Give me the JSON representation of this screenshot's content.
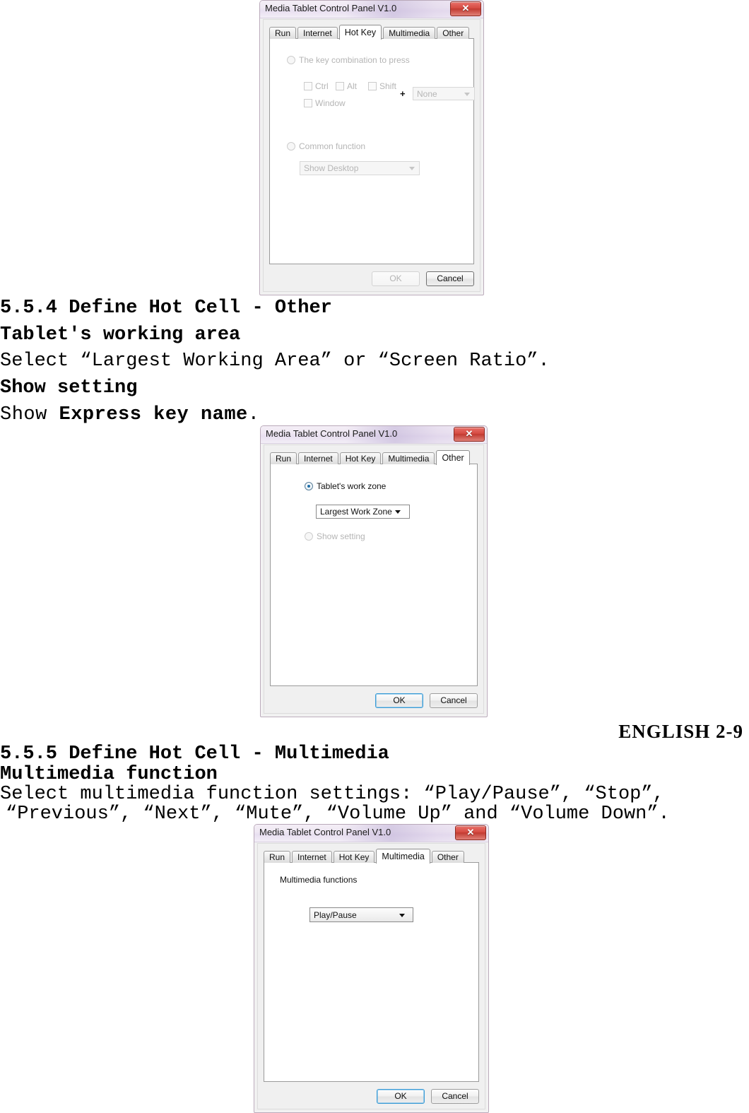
{
  "document": {
    "lines": [
      {
        "id": "s554_heading",
        "text": "5.5.4 Define Hot Cell - Other"
      },
      {
        "id": "s554_sub1",
        "text": "Tablet's working area"
      },
      {
        "id": "s554_body1",
        "text": "Select “Largest Working Area” or “Screen Ratio”."
      },
      {
        "id": "s554_sub2",
        "text": "Show setting"
      },
      {
        "id": "s554_mix_prefix",
        "text": "Show "
      },
      {
        "id": "s554_mix_bold",
        "text": "Express key name"
      },
      {
        "id": "s554_mix_suffix",
        "text": "."
      },
      {
        "id": "s555_heading",
        "text": "5.5.5 Define Hot Cell - Multimedia"
      },
      {
        "id": "s555_sub1",
        "text": "Multimedia function"
      },
      {
        "id": "s555_body1",
        "text": "Select multimedia function settings: “Play/Pause”, “Stop”,"
      },
      {
        "id": "s555_body2",
        "text": "“Previous”, “Next”, “Mute”, “Volume Up” and “Volume Down”."
      }
    ],
    "footer": "ENGLISH 2-9"
  },
  "common": {
    "window_title": "Media Tablet Control Panel V1.0",
    "close_icon": "close-icon",
    "close_glyph": "✕",
    "tabs": [
      "Run",
      "Internet",
      "Hot Key",
      "Multimedia",
      "Other"
    ],
    "ok_label": "OK",
    "cancel_label": "Cancel",
    "accent_focus_color": "#3c9cd6",
    "close_button_color": "#c23a31",
    "titlebar_color": "#efe8f3"
  },
  "dialog_hotkey": {
    "active_tab": "Hot Key",
    "radio_key_combo": {
      "label": "The key combination to press",
      "selected": false,
      "enabled": false
    },
    "checkboxes": [
      {
        "label": "Ctrl",
        "checked": false,
        "enabled": false
      },
      {
        "label": "Alt",
        "checked": false,
        "enabled": false
      },
      {
        "label": "Shift",
        "checked": false,
        "enabled": false
      },
      {
        "label": "Window",
        "checked": false,
        "enabled": false
      }
    ],
    "plus": "+",
    "key_combo_value": "None",
    "key_combo_enabled": false,
    "radio_common_function": {
      "label": "Common function",
      "selected": false,
      "enabled": false
    },
    "common_function_value": "Show Desktop",
    "common_function_enabled": false,
    "ok_enabled": false,
    "cancel_focused": false
  },
  "dialog_other": {
    "active_tab": "Other",
    "radio_work_zone": {
      "label": "Tablet's work zone",
      "selected": true,
      "enabled": true
    },
    "work_zone_value": "Largest Work Zone",
    "radio_show_setting": {
      "label": "Show setting",
      "selected": false,
      "enabled": false
    },
    "ok_enabled": true,
    "ok_focused": true
  },
  "dialog_multimedia": {
    "active_tab": "Multimedia",
    "group_label": "Multimedia functions",
    "function_value": "Play/Pause",
    "ok_enabled": true,
    "ok_focused": true
  }
}
